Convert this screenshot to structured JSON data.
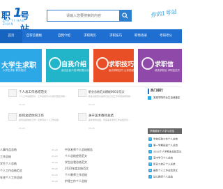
{
  "header": {
    "logo_text_a": "职",
    "logo_text_num": "1",
    "logo_text_b": "号站",
    "logo_sub": "ZHI YI HAO ZHAN",
    "search_placeholder": "请输入您要搜索的内容",
    "slogan": "你的1号站"
  },
  "nav": {
    "items": [
      {
        "label": "首页"
      },
      {
        "label": "自荐信模板"
      },
      {
        "label": "自我介绍"
      },
      {
        "label": "求职简历"
      },
      {
        "label": "求职技巧"
      },
      {
        "label": "职场语录"
      },
      {
        "label": "考研考公"
      }
    ]
  },
  "banners": [
    {
      "title": "大学生求职",
      "sub": "大学生求职 职场规划"
    },
    {
      "title": "自我介绍",
      "sub": "面试自我介绍 精彩展示自己"
    },
    {
      "title": "求职技巧",
      "sub": "面试求职技巧 让你脱颖而出"
    },
    {
      "title": "求职信",
      "sub": "精选求职信 求职信范文"
    }
  ],
  "articles": [
    {
      "title": "个人总工作总结范文",
      "desc": "个人工作总结范文，工作总结可以让我们更加清晰…",
      "date": "05-28"
    },
    {
      "title": "职业总结范文模板600字范文",
      "desc": "职业总结范文是我们在日常工作中经常用到的…",
      "date": "05-28"
    },
    {
      "title": "如何总结你的工作",
      "desc": "如何总结你的工作？怎样写好个人工作总结…",
      "date": "05-28"
    },
    {
      "title": "关于美术教师总结",
      "desc": "美术教师总结，年度美术老师工作总结范文…",
      "date": "05-28"
    }
  ],
  "sidebar": {
    "heading": "热门排行",
    "hot_item": "某某学院毕业生自我鉴定",
    "box_title": "学期期末个人学习总结",
    "list": [
      {
        "num": "1",
        "text": "学校后勤工作个人总结"
      },
      {
        "num": "2",
        "text": "第一学期班级个人总结"
      },
      {
        "num": "3",
        "text": "2023个人学期末总结范文"
      },
      {
        "num": "4",
        "text": "高中学习个人总结"
      },
      {
        "num": "5",
        "text": "新员工转正个人总结"
      },
      {
        "num": "6",
        "text": "最新个人工作总结范文"
      },
      {
        "num": "7",
        "text": "幼儿教师个人总结"
      }
    ]
  },
  "bottom": {
    "left": [
      {
        "text": "人事作品总结"
      },
      {
        "text": "工作总结"
      },
      {
        "text": "学生个人总结"
      },
      {
        "text": "个人工作总结范文"
      },
      {
        "text": "年终个人工作总结"
      }
    ],
    "middle": [
      {
        "text": "中学老师个人总结报告",
        "date": "05-28"
      },
      {
        "text": "个人总结经验范文",
        "date": "05-28"
      },
      {
        "text": "学生自我总结范文",
        "date": "05-28"
      },
      {
        "text": "2023年度总结范文",
        "date": "05-28"
      },
      {
        "text": "个人教师工作总结",
        "date": "05-28"
      },
      {
        "text": "护理工作个人总结",
        "date": "05-28"
      }
    ]
  },
  "colors": {
    "brand_blue": "#1e6fd0",
    "banner1": "#2ca8e6",
    "banner2": "#22b4c9",
    "banner3": "#e94f26",
    "banner4": "#8f49a8"
  }
}
